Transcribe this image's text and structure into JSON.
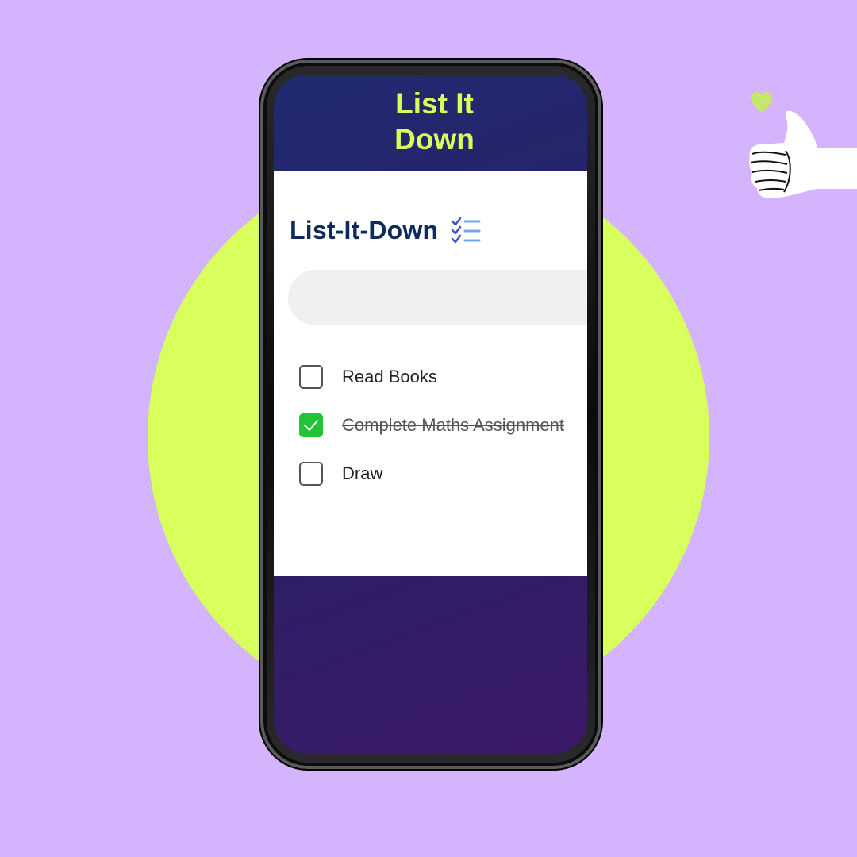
{
  "app": {
    "title": "List It\nDown",
    "heading": "List-It-Down",
    "heading_icon": "checklist-icon"
  },
  "search": {
    "value": "",
    "placeholder": ""
  },
  "tasks": [
    {
      "label": "Read Books",
      "checked": false
    },
    {
      "label": "Complete Maths Assignment",
      "checked": true
    },
    {
      "label": "Draw",
      "checked": false
    }
  ],
  "colors": {
    "background": "#d4b5fd",
    "accent_lime": "#d9ff5c",
    "header_navy": "#202a70",
    "heading_text": "#0f2a5c",
    "checked_green": "#22c337"
  },
  "decorations": {
    "thumb": "thumbs-up-icon",
    "heart": "heart-icon"
  }
}
